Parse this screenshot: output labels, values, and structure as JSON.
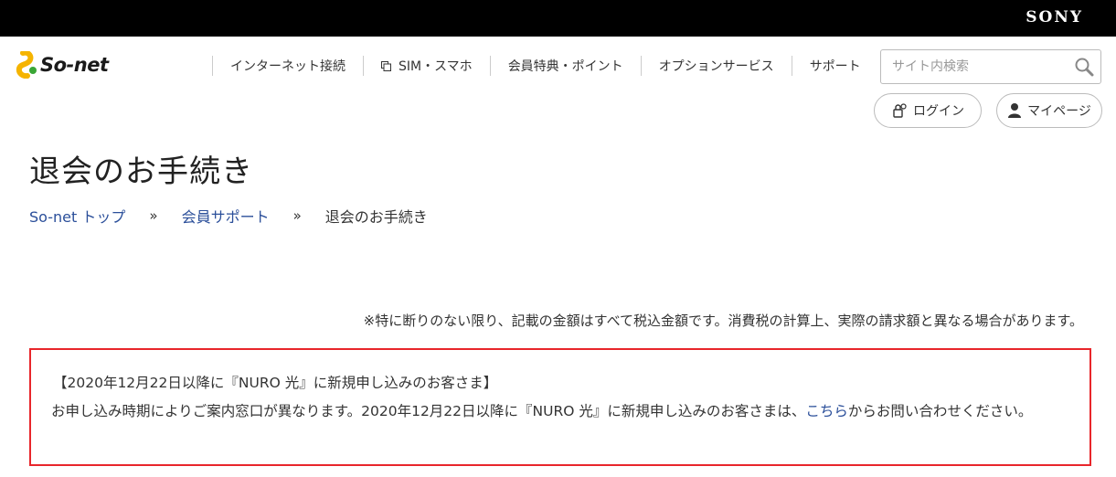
{
  "header": {
    "corporate_logo": "SONY",
    "brand_name": "So-net"
  },
  "nav": {
    "items": [
      {
        "label": "インターネット接続"
      },
      {
        "label": "SIM・スマホ"
      },
      {
        "label": "会員特典・ポイント"
      },
      {
        "label": "オプションサービス"
      },
      {
        "label": "サポート"
      }
    ]
  },
  "search": {
    "placeholder": "サイト内検索",
    "icon": "search-icon"
  },
  "account": {
    "login_label": "ログイン",
    "mypage_label": "マイページ"
  },
  "page": {
    "title": "退会のお手続き"
  },
  "breadcrumb": {
    "items": [
      "So-net トップ",
      "会員サポート",
      "退会のお手続き"
    ],
    "separator": "»"
  },
  "tax_note": "※特に断りのない限り、記載の金額はすべて税込金額です。消費税の計算上、実際の請求額と異なる場合があります。",
  "notice": {
    "heading": "【2020年12月22日以降に『NURO 光』に新規申し込みのお客さま】",
    "body_before": "お申し込み時期によりご案内窓口が異なります。2020年12月22日以降に『NURO 光』に新規申し込みのお客さまは、",
    "link": "こちら",
    "body_after": "からお問い合わせください。"
  },
  "colors": {
    "link": "#2b4f9a",
    "notice_border": "#e8262b",
    "top_bar": "#000000"
  }
}
